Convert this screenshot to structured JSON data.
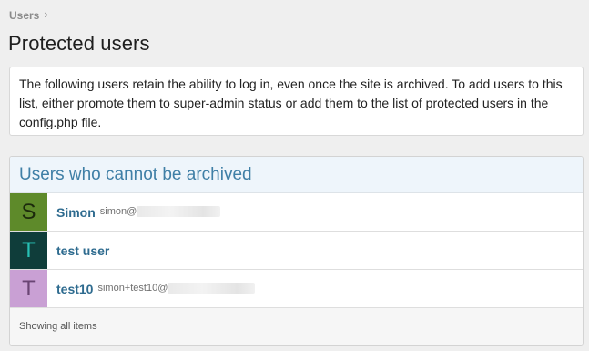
{
  "breadcrumb": {
    "items": [
      "Users"
    ],
    "separator_icon": "chevron-right-icon"
  },
  "page": {
    "title": "Protected users"
  },
  "info": {
    "text": "The following users retain the ability to log in, even once the site is archived. To add users to this list, either promote them to super-admin status or add them to the list of protected users in the config.php file."
  },
  "panel": {
    "title": "Users who cannot be archived",
    "footer": "Showing all items",
    "users": [
      {
        "initial": "S",
        "name": "Simon",
        "email": "simon@",
        "avatar_bg": "#5e8a2a",
        "avatar_fg": "#1c2a0c"
      },
      {
        "initial": "T",
        "name": "test user",
        "email": "",
        "avatar_bg": "#0f3d3a",
        "avatar_fg": "#27c0b4"
      },
      {
        "initial": "T",
        "name": "test10",
        "email": "simon+test10@",
        "avatar_bg": "#c9a0d4",
        "avatar_fg": "#6a4574"
      }
    ]
  }
}
